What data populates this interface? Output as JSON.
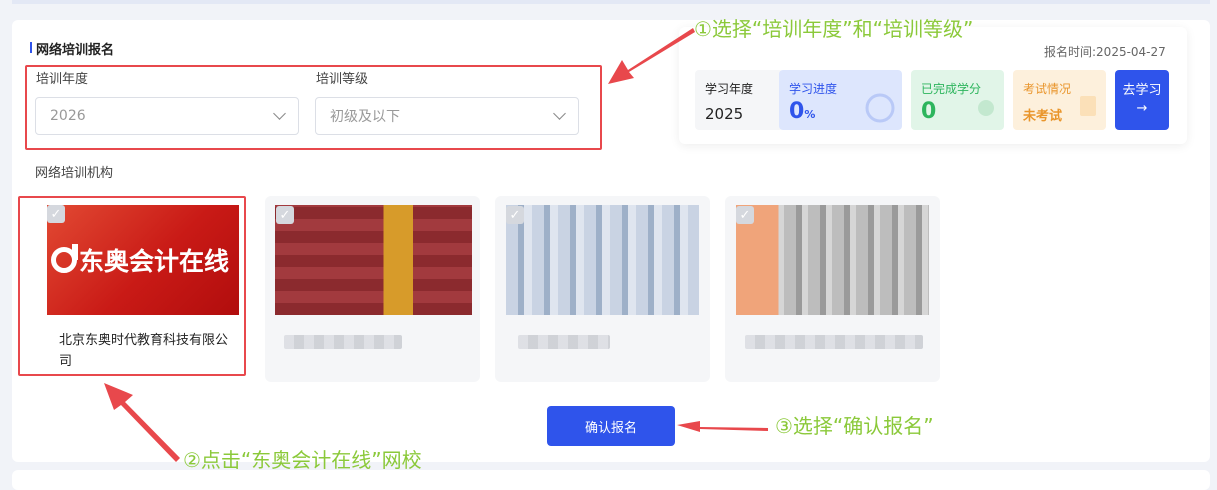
{
  "form": {
    "section_title": "网络培训报名",
    "year_label": "培训年度",
    "year_value": "2026",
    "level_label": "培训等级",
    "level_value": "初级及以下",
    "org_label": "网络培训机构"
  },
  "orgs": [
    {
      "logo_text": "东奥会计在线",
      "name": "北京东奥时代教育科技有限公司",
      "checked": true
    }
  ],
  "confirm_label": "确认报名",
  "panel": {
    "date_label": "报名时间:",
    "date_value": "2025-04-27",
    "year_label": "学习年度",
    "year_value": "2025",
    "progress_label": "学习进度",
    "progress_value": "0",
    "progress_unit": "%",
    "credit_label": "已完成学分",
    "credit_value": "0",
    "exam_label": "考试情况",
    "exam_value": "未考试",
    "go_label": "去学习",
    "go_arrow": "→"
  },
  "annotations": {
    "step1": "①选择“培训年度”和“培训等级”",
    "step2": "②点击“东奥会计在线”网校",
    "step3": "③选择“确认报名”"
  },
  "colors": {
    "accent": "#2f54eb",
    "highlight": "#e8484c",
    "annotation": "#8bc93a"
  }
}
